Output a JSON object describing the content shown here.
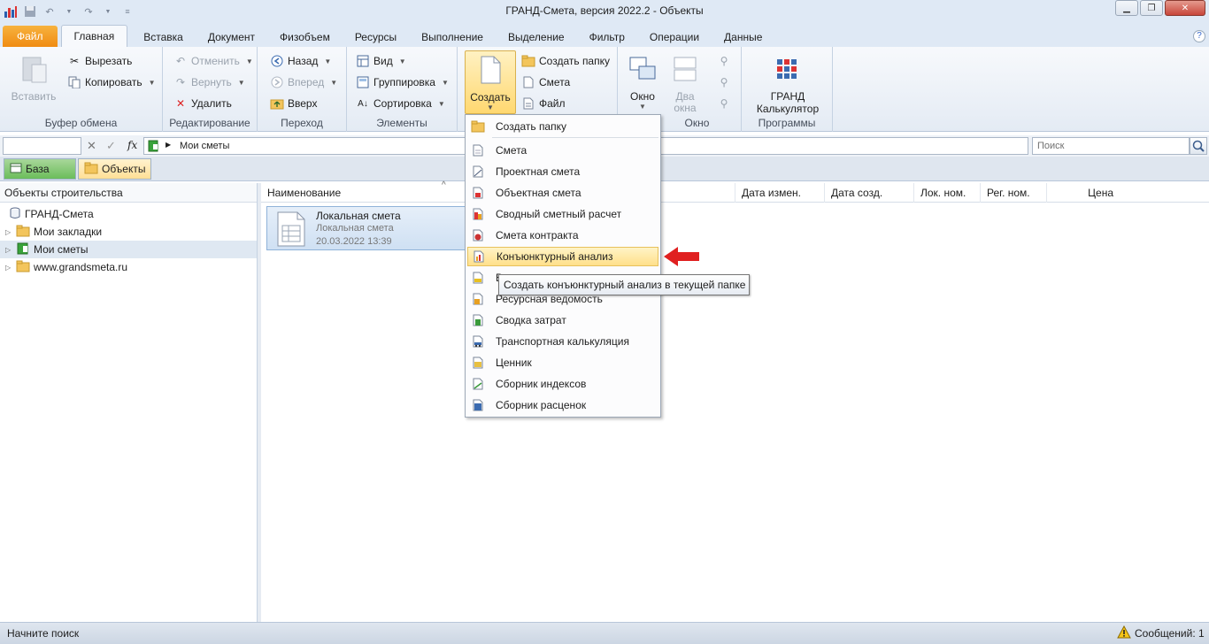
{
  "window": {
    "title": "ГРАНД-Смета, версия 2022.2 - Объекты"
  },
  "tabs": [
    {
      "label": "Файл"
    },
    {
      "label": "Главная"
    },
    {
      "label": "Вставка"
    },
    {
      "label": "Документ"
    },
    {
      "label": "Физобъем"
    },
    {
      "label": "Ресурсы"
    },
    {
      "label": "Выполнение"
    },
    {
      "label": "Выделение"
    },
    {
      "label": "Фильтр"
    },
    {
      "label": "Операции"
    },
    {
      "label": "Данные"
    }
  ],
  "ribbon": {
    "clipboard": {
      "label": "Буфер обмена",
      "paste": "Вставить",
      "cut": "Вырезать",
      "copy": "Копировать"
    },
    "edit": {
      "label": "Редактирование",
      "undo": "Отменить",
      "redo": "Вернуть",
      "delete": "Удалить"
    },
    "nav": {
      "label": "Переход",
      "back": "Назад",
      "forward": "Вперед",
      "up": "Вверх"
    },
    "elements": {
      "label": "Элементы",
      "view": "Вид",
      "group": "Группировка",
      "sort": "Сортировка"
    },
    "create": {
      "create": "Создать",
      "folder": "Создать папку",
      "estimate": "Смета",
      "file": "Файл"
    },
    "window": {
      "label": "Окно",
      "window": "Окно",
      "two_line1": "Два",
      "two_line2": "окна"
    },
    "programs": {
      "label": "Программы",
      "calc_line1": "ГРАНД",
      "calc_line2": "Калькулятор"
    }
  },
  "addressbar": {
    "path": "Мои сметы",
    "search_placeholder": "Поиск"
  },
  "dbtabs": [
    {
      "label": "База"
    },
    {
      "label": "Объекты"
    }
  ],
  "leftpane": {
    "header": "Объекты строительства",
    "items": [
      {
        "label": "ГРАНД-Смета"
      },
      {
        "label": "Мои закладки"
      },
      {
        "label": "Мои сметы"
      },
      {
        "label": "www.grandsmeta.ru"
      }
    ]
  },
  "columns": [
    "Наименование",
    "Дата измен.",
    "Дата созд.",
    "Лок. ном.",
    "Рег. ном.",
    "Цена"
  ],
  "file_item": {
    "name": "Локальная смета",
    "type": "Локальная смета",
    "date": "20.03.2022 13:39"
  },
  "menu": {
    "items": [
      {
        "label": "Создать папку"
      },
      {
        "label": "Смета"
      },
      {
        "label": "Проектная смета"
      },
      {
        "label": "Объектная смета"
      },
      {
        "label": "Сводный сметный расчет"
      },
      {
        "label": "Смета контракта"
      },
      {
        "label": "Конъюнктурный анализ"
      },
      {
        "label": "В"
      },
      {
        "label": "Ресурсная ведомость"
      },
      {
        "label": "Сводка затрат"
      },
      {
        "label": "Транспортная калькуляция"
      },
      {
        "label": "Ценник"
      },
      {
        "label": "Сборник индексов"
      },
      {
        "label": "Сборник расценок"
      }
    ]
  },
  "tooltip": "Создать конъюнктурный анализ в текущей папке",
  "status": {
    "left": "Начните поиск",
    "right": "Сообщений: 1"
  },
  "colors": {
    "accent": "#f08c12",
    "highlight": "#ffe08a",
    "arrow": "#e02020"
  }
}
